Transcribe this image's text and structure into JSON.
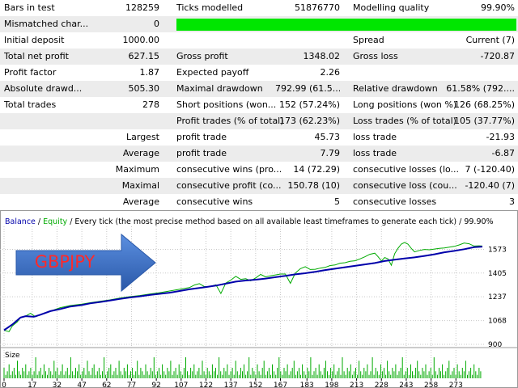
{
  "report": {
    "rows": [
      {
        "cells": [
          {
            "text": "Bars in test",
            "col": "c1",
            "align": "l"
          },
          {
            "text": "128259",
            "col": "c2",
            "align": "r"
          },
          {
            "text": "Ticks modelled",
            "col": "c3",
            "align": "l"
          },
          {
            "text": "51876770",
            "col": "c4",
            "align": "r"
          },
          {
            "text": "Modelling quality",
            "col": "c5",
            "align": "l"
          },
          {
            "text": "99.90%",
            "col": "c6",
            "align": "r"
          }
        ]
      },
      {
        "cells": [
          {
            "text": "Mismatched char...",
            "col": "c1",
            "align": "l"
          },
          {
            "text": "0",
            "col": "c2",
            "align": "r"
          }
        ],
        "quality_bar": true
      },
      {
        "cells": [
          {
            "text": "Initial deposit",
            "col": "c1",
            "align": "l"
          },
          {
            "text": "1000.00",
            "col": "c2",
            "align": "r"
          },
          {
            "text": "Spread",
            "col": "c5",
            "align": "l"
          },
          {
            "text": "Current (7)",
            "col": "c6",
            "align": "r"
          }
        ]
      },
      {
        "cells": [
          {
            "text": "Total net profit",
            "col": "c1",
            "align": "l"
          },
          {
            "text": "627.15",
            "col": "c2",
            "align": "r"
          },
          {
            "text": "Gross profit",
            "col": "c3",
            "align": "l"
          },
          {
            "text": "1348.02",
            "col": "c4",
            "align": "r"
          },
          {
            "text": "Gross loss",
            "col": "c5",
            "align": "l"
          },
          {
            "text": "-720.87",
            "col": "c6",
            "align": "r"
          }
        ]
      },
      {
        "cells": [
          {
            "text": "Profit factor",
            "col": "c1",
            "align": "l"
          },
          {
            "text": "1.87",
            "col": "c2",
            "align": "r"
          },
          {
            "text": "Expected payoff",
            "col": "c3",
            "align": "l"
          },
          {
            "text": "2.26",
            "col": "c4",
            "align": "r"
          }
        ]
      },
      {
        "cells": [
          {
            "text": "Absolute drawd...",
            "col": "c1",
            "align": "l"
          },
          {
            "text": "505.30",
            "col": "c2",
            "align": "r"
          },
          {
            "text": "Maximal drawdown",
            "col": "c3",
            "align": "l"
          },
          {
            "text": "792.99 (61.5...",
            "col": "c4",
            "align": "r"
          },
          {
            "text": "Relative drawdown",
            "col": "c5",
            "align": "l"
          },
          {
            "text": "61.58% (792....",
            "col": "c6",
            "align": "r"
          }
        ]
      },
      {
        "cells": [
          {
            "text": "Total trades",
            "col": "c1",
            "align": "l"
          },
          {
            "text": "278",
            "col": "c2",
            "align": "r"
          },
          {
            "text": "Short positions (won...",
            "col": "c3",
            "align": "l"
          },
          {
            "text": "152 (57.24%)",
            "col": "c4",
            "align": "r"
          },
          {
            "text": "Long positions (won %)",
            "col": "c5",
            "align": "l"
          },
          {
            "text": "126 (68.25%)",
            "col": "c6",
            "align": "r"
          }
        ]
      },
      {
        "cells": [
          {
            "text": "Profit trades (% of total)",
            "col": "c3",
            "align": "l"
          },
          {
            "text": "173 (62.23%)",
            "col": "c4",
            "align": "r"
          },
          {
            "text": "Loss trades (% of total)",
            "col": "c5",
            "align": "l"
          },
          {
            "text": "105 (37.77%)",
            "col": "c6",
            "align": "r"
          }
        ]
      },
      {
        "cells": [
          {
            "text": "Largest",
            "col": "c1r",
            "align": "r"
          },
          {
            "text": "profit trade",
            "col": "c3",
            "align": "l"
          },
          {
            "text": "45.73",
            "col": "c4",
            "align": "r"
          },
          {
            "text": "loss trade",
            "col": "c5",
            "align": "l"
          },
          {
            "text": "-21.93",
            "col": "c6",
            "align": "r"
          }
        ]
      },
      {
        "cells": [
          {
            "text": "Average",
            "col": "c1r",
            "align": "r"
          },
          {
            "text": "profit trade",
            "col": "c3",
            "align": "l"
          },
          {
            "text": "7.79",
            "col": "c4",
            "align": "r"
          },
          {
            "text": "loss trade",
            "col": "c5",
            "align": "l"
          },
          {
            "text": "-6.87",
            "col": "c6",
            "align": "r"
          }
        ]
      },
      {
        "cells": [
          {
            "text": "Maximum",
            "col": "c1r",
            "align": "r"
          },
          {
            "text": "consecutive wins (pro...",
            "col": "c3",
            "align": "l"
          },
          {
            "text": "14 (72.29)",
            "col": "c4",
            "align": "r"
          },
          {
            "text": "consecutive losses (lo...",
            "col": "c5",
            "align": "l"
          },
          {
            "text": "7 (-120.40)",
            "col": "c6",
            "align": "r"
          }
        ]
      },
      {
        "cells": [
          {
            "text": "Maximal",
            "col": "c1r",
            "align": "r"
          },
          {
            "text": "consecutive profit (co...",
            "col": "c3",
            "align": "l"
          },
          {
            "text": "150.78 (10)",
            "col": "c4",
            "align": "r"
          },
          {
            "text": "consecutive loss (cou...",
            "col": "c5",
            "align": "l"
          },
          {
            "text": "-120.40 (7)",
            "col": "c6",
            "align": "r"
          }
        ]
      },
      {
        "cells": [
          {
            "text": "Average",
            "col": "c1r",
            "align": "r"
          },
          {
            "text": "consecutive wins",
            "col": "c3",
            "align": "l"
          },
          {
            "text": "5",
            "col": "c4",
            "align": "r"
          },
          {
            "text": "consecutive losses",
            "col": "c5",
            "align": "l"
          },
          {
            "text": "3",
            "col": "c6",
            "align": "r"
          }
        ]
      }
    ]
  },
  "chart_data": {
    "type": "line",
    "legend": {
      "balance": "Balance",
      "sep": " / ",
      "equity": "Equity"
    },
    "description": " / Every tick (the most precise method based on all available least timeframes to generate each tick) / 99.90%",
    "annotation": "GBPJPY",
    "y_ticks": [
      "1573",
      "1405",
      "1237",
      "1068",
      "900"
    ],
    "y_tick_values": [
      1573,
      1405,
      1237,
      1068,
      900
    ],
    "ylim": [
      900,
      1690
    ],
    "xlim": [
      0,
      289
    ],
    "x_ticks": [
      "0",
      "17",
      "32",
      "47",
      "62",
      "77",
      "92",
      "107",
      "122",
      "137",
      "152",
      "167",
      "183",
      "198",
      "213",
      "228",
      "243",
      "258",
      "273"
    ],
    "size_label": "Size",
    "balance": [
      [
        0,
        1000
      ],
      [
        5,
        1040
      ],
      [
        10,
        1090
      ],
      [
        13,
        1100
      ],
      [
        18,
        1095
      ],
      [
        22,
        1110
      ],
      [
        28,
        1135
      ],
      [
        34,
        1150
      ],
      [
        40,
        1168
      ],
      [
        47,
        1178
      ],
      [
        52,
        1190
      ],
      [
        58,
        1200
      ],
      [
        64,
        1210
      ],
      [
        70,
        1222
      ],
      [
        76,
        1232
      ],
      [
        82,
        1240
      ],
      [
        88,
        1250
      ],
      [
        94,
        1258
      ],
      [
        100,
        1266
      ],
      [
        106,
        1278
      ],
      [
        112,
        1290
      ],
      [
        117,
        1298
      ],
      [
        122,
        1306
      ],
      [
        128,
        1316
      ],
      [
        134,
        1330
      ],
      [
        140,
        1344
      ],
      [
        146,
        1352
      ],
      [
        152,
        1358
      ],
      [
        158,
        1366
      ],
      [
        164,
        1376
      ],
      [
        170,
        1385
      ],
      [
        176,
        1396
      ],
      [
        182,
        1404
      ],
      [
        188,
        1414
      ],
      [
        194,
        1426
      ],
      [
        200,
        1436
      ],
      [
        206,
        1446
      ],
      [
        212,
        1456
      ],
      [
        218,
        1466
      ],
      [
        224,
        1476
      ],
      [
        230,
        1490
      ],
      [
        236,
        1500
      ],
      [
        242,
        1508
      ],
      [
        248,
        1516
      ],
      [
        254,
        1526
      ],
      [
        260,
        1538
      ],
      [
        266,
        1552
      ],
      [
        272,
        1562
      ],
      [
        278,
        1574
      ],
      [
        284,
        1588
      ],
      [
        289,
        1592
      ]
    ],
    "equity": [
      [
        0,
        1000
      ],
      [
        3,
        990
      ],
      [
        5,
        1030
      ],
      [
        8,
        1060
      ],
      [
        10,
        1090
      ],
      [
        13,
        1100
      ],
      [
        16,
        1120
      ],
      [
        19,
        1095
      ],
      [
        22,
        1110
      ],
      [
        28,
        1135
      ],
      [
        34,
        1160
      ],
      [
        40,
        1175
      ],
      [
        47,
        1185
      ],
      [
        52,
        1195
      ],
      [
        58,
        1205
      ],
      [
        64,
        1215
      ],
      [
        70,
        1228
      ],
      [
        76,
        1238
      ],
      [
        82,
        1246
      ],
      [
        88,
        1256
      ],
      [
        94,
        1266
      ],
      [
        100,
        1278
      ],
      [
        106,
        1290
      ],
      [
        112,
        1302
      ],
      [
        115,
        1320
      ],
      [
        118,
        1330
      ],
      [
        121,
        1310
      ],
      [
        124,
        1308
      ],
      [
        128,
        1322
      ],
      [
        131,
        1260
      ],
      [
        134,
        1334
      ],
      [
        137,
        1355
      ],
      [
        140,
        1382
      ],
      [
        143,
        1360
      ],
      [
        146,
        1365
      ],
      [
        149,
        1350
      ],
      [
        152,
        1370
      ],
      [
        155,
        1395
      ],
      [
        158,
        1378
      ],
      [
        161,
        1385
      ],
      [
        164,
        1392
      ],
      [
        167,
        1398
      ],
      [
        170,
        1398
      ],
      [
        173,
        1332
      ],
      [
        176,
        1405
      ],
      [
        179,
        1436
      ],
      [
        182,
        1450
      ],
      [
        185,
        1430
      ],
      [
        188,
        1432
      ],
      [
        191,
        1440
      ],
      [
        194,
        1445
      ],
      [
        197,
        1458
      ],
      [
        200,
        1462
      ],
      [
        203,
        1475
      ],
      [
        206,
        1478
      ],
      [
        209,
        1488
      ],
      [
        212,
        1492
      ],
      [
        215,
        1505
      ],
      [
        218,
        1520
      ],
      [
        221,
        1538
      ],
      [
        224,
        1546
      ],
      [
        226,
        1520
      ],
      [
        228,
        1490
      ],
      [
        230,
        1515
      ],
      [
        232,
        1505
      ],
      [
        234,
        1460
      ],
      [
        236,
        1542
      ],
      [
        238,
        1580
      ],
      [
        240,
        1610
      ],
      [
        242,
        1622
      ],
      [
        244,
        1610
      ],
      [
        246,
        1580
      ],
      [
        248,
        1555
      ],
      [
        251,
        1565
      ],
      [
        254,
        1572
      ],
      [
        257,
        1570
      ],
      [
        260,
        1575
      ],
      [
        263,
        1580
      ],
      [
        266,
        1583
      ],
      [
        269,
        1588
      ],
      [
        272,
        1594
      ],
      [
        275,
        1604
      ],
      [
        278,
        1618
      ],
      [
        281,
        1612
      ],
      [
        284,
        1596
      ],
      [
        287,
        1598
      ],
      [
        289,
        1596
      ]
    ],
    "size": [
      3,
      1,
      2,
      4,
      1,
      2,
      3,
      1,
      5,
      2,
      1,
      3,
      2,
      4,
      1,
      2,
      3,
      1,
      2,
      6,
      1,
      2,
      3,
      1,
      4,
      2,
      1,
      3,
      2,
      1,
      5,
      2,
      3,
      1,
      2,
      4,
      1,
      2,
      3,
      1,
      6,
      2,
      1,
      3,
      2,
      4,
      1,
      2,
      3,
      1,
      5,
      2,
      1,
      3,
      4,
      1,
      2,
      3,
      1,
      2,
      6,
      1,
      2,
      3,
      4,
      1,
      2,
      3,
      1,
      5,
      2,
      1,
      3,
      2,
      4,
      1,
      2,
      3,
      1,
      2,
      5,
      1,
      3,
      2,
      1,
      4,
      2,
      1,
      3,
      2,
      6,
      1,
      2,
      3,
      1,
      4,
      2,
      1,
      3,
      2,
      5,
      1,
      2,
      3,
      1,
      4,
      2,
      1,
      3,
      6,
      2,
      1,
      3,
      2,
      4,
      1,
      2,
      3,
      1,
      5,
      2,
      1,
      3,
      2,
      1,
      4,
      2,
      3,
      1,
      6,
      2,
      1,
      3,
      2,
      4,
      1,
      2,
      3,
      1,
      5,
      2,
      1,
      3,
      2,
      4,
      1,
      2,
      6,
      1,
      3,
      2,
      1,
      4,
      2,
      1,
      3,
      5,
      1,
      2,
      3,
      1,
      4,
      2,
      1,
      3,
      6,
      2,
      1,
      3,
      2,
      4,
      1,
      2,
      3,
      5,
      1,
      2,
      3,
      1,
      4,
      2,
      1,
      3,
      2,
      6,
      1,
      2,
      3,
      1,
      4,
      2,
      1,
      3,
      5,
      2,
      1,
      3,
      2,
      4,
      1,
      2,
      3,
      1,
      6,
      2,
      1,
      3,
      2,
      4,
      1,
      2,
      3,
      1,
      5,
      2,
      1,
      3,
      2,
      4,
      1,
      2,
      6,
      1,
      3,
      2,
      1,
      4,
      2,
      3,
      1,
      5,
      2,
      1,
      3,
      2,
      4,
      1,
      2,
      3,
      6,
      1,
      2,
      3,
      1,
      4,
      2,
      1,
      3,
      5,
      2,
      1,
      3,
      2,
      4,
      1,
      2,
      3,
      1,
      6,
      2,
      1,
      3,
      2,
      4,
      1,
      2,
      3,
      5,
      1,
      2,
      3,
      1,
      4,
      2,
      1,
      3,
      2,
      5,
      1,
      2,
      3,
      1,
      4,
      2,
      1,
      3,
      2
    ],
    "colors": {
      "balance": "#0000aa",
      "equity": "#00aa00",
      "size": "#00aa00",
      "arrow_fill": "#3a6fc4",
      "arrow_text": "#ff2a2a",
      "grid": "#c8c8c8",
      "axis_text": "#000000"
    }
  }
}
